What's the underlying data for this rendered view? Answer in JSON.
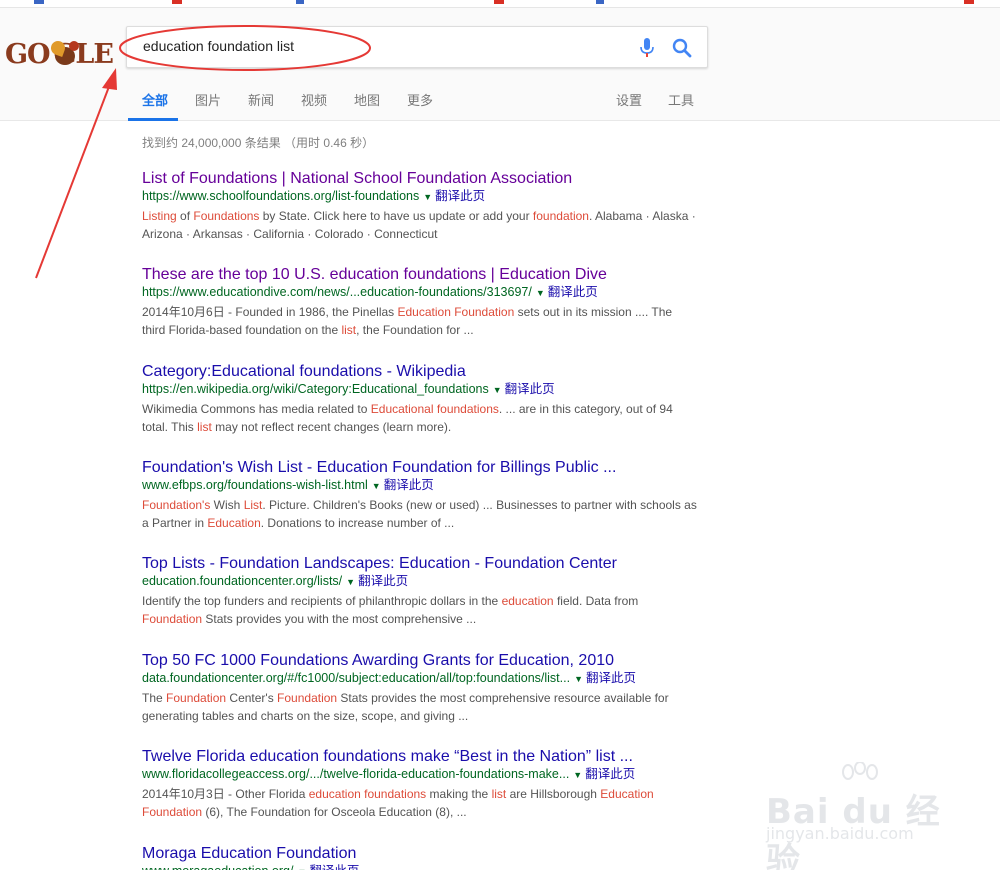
{
  "search": {
    "query": "education foundation list",
    "mic_icon": "mic-icon",
    "search_icon": "search-icon"
  },
  "tabs": [
    {
      "label": "全部",
      "active": true
    },
    {
      "label": "图片"
    },
    {
      "label": "新闻"
    },
    {
      "label": "视频"
    },
    {
      "label": "地图"
    },
    {
      "label": "更多"
    }
  ],
  "tools": {
    "settings": "设置",
    "tools": "工具"
  },
  "stats": "找到约 24,000,000 条结果 （用时 0.46 秒）",
  "translate_label": "翻译此页",
  "results": [
    {
      "title": "List of Foundations | National School Foundation Association",
      "url": "https://www.schoolfoundations.org/list-foundations",
      "visited": true,
      "snippet": [
        {
          "t": "Listing",
          "hl": true
        },
        {
          "t": " of "
        },
        {
          "t": "Foundations",
          "hl": true
        },
        {
          "t": " by State. Click here to have us update or add your "
        },
        {
          "t": "foundation",
          "hl": true
        },
        {
          "t": ". Alabama · Alaska · Arizona · Arkansas · California · Colorado · Connecticut"
        }
      ]
    },
    {
      "title": "These are the top 10 U.S. education foundations | Education Dive",
      "url": "https://www.educationdive.com/news/...education-foundations/313697/",
      "visited": true,
      "snippet": [
        {
          "t": "2014年10月6日 - Founded in 1986, the Pinellas "
        },
        {
          "t": "Education Foundation",
          "hl": true
        },
        {
          "t": " sets out in its mission .... The third Florida-based foundation on the "
        },
        {
          "t": "list",
          "hl": true
        },
        {
          "t": ", the Foundation for ..."
        }
      ]
    },
    {
      "title": "Category:Educational foundations - Wikipedia",
      "url": "https://en.wikipedia.org/wiki/Category:Educational_foundations",
      "visited": false,
      "snippet": [
        {
          "t": "Wikimedia Commons has media related to "
        },
        {
          "t": "Educational foundations",
          "hl": true
        },
        {
          "t": ". ... are in this category, out of 94 total. This "
        },
        {
          "t": "list",
          "hl": true
        },
        {
          "t": " may not reflect recent changes (learn more)."
        }
      ]
    },
    {
      "title": "Foundation's Wish List - Education Foundation for Billings Public ...",
      "url": "www.efbps.org/foundations-wish-list.html",
      "visited": false,
      "snippet": [
        {
          "t": "Foundation's",
          "hl": true
        },
        {
          "t": " Wish "
        },
        {
          "t": "List",
          "hl": true
        },
        {
          "t": ". Picture. Children's Books (new or used) ... Businesses to partner with schools as a Partner in "
        },
        {
          "t": "Education",
          "hl": true
        },
        {
          "t": ". Donations to increase number of ..."
        }
      ]
    },
    {
      "title": "Top Lists - Foundation Landscapes: Education - Foundation Center",
      "url": "education.foundationcenter.org/lists/",
      "visited": false,
      "snippet": [
        {
          "t": "Identify the top funders and recipients of philanthropic dollars in the "
        },
        {
          "t": "education",
          "hl": true
        },
        {
          "t": " field. Data from "
        },
        {
          "t": "Foundation",
          "hl": true
        },
        {
          "t": " Stats provides you with the most comprehensive ..."
        }
      ]
    },
    {
      "title": "Top 50 FC 1000 Foundations Awarding Grants for Education, 2010",
      "url": "data.foundationcenter.org/#/fc1000/subject:education/all/top:foundations/list...",
      "visited": false,
      "snippet": [
        {
          "t": "The "
        },
        {
          "t": "Foundation",
          "hl": true
        },
        {
          "t": " Center's "
        },
        {
          "t": "Foundation",
          "hl": true
        },
        {
          "t": " Stats provides the most comprehensive resource available for generating tables and charts on the size, scope, and giving ..."
        }
      ]
    },
    {
      "title": "Twelve Florida education foundations make “Best in the Nation” list ...",
      "url": "www.floridacollegeaccess.org/.../twelve-florida-education-foundations-make...",
      "visited": false,
      "snippet": [
        {
          "t": "2014年10月3日 - Other Florida "
        },
        {
          "t": "education foundations",
          "hl": true
        },
        {
          "t": " making the "
        },
        {
          "t": "list",
          "hl": true
        },
        {
          "t": " are Hillsborough "
        },
        {
          "t": "Education Foundation",
          "hl": true
        },
        {
          "t": " (6), The Foundation for Osceola Education (8), ..."
        }
      ]
    },
    {
      "title": "Moraga Education Foundation",
      "url": "www.moragaeducation.org/",
      "visited": false,
      "snippet": []
    }
  ],
  "watermark": {
    "brand": "Bai du 经验",
    "sub": "jingyan.baidu.com"
  },
  "colors": {
    "link": "#1a0dab",
    "visited": "#660099",
    "url": "#006621",
    "highlight": "#dd4b39",
    "accent": "#1a73e8",
    "annotation": "#e53935"
  }
}
